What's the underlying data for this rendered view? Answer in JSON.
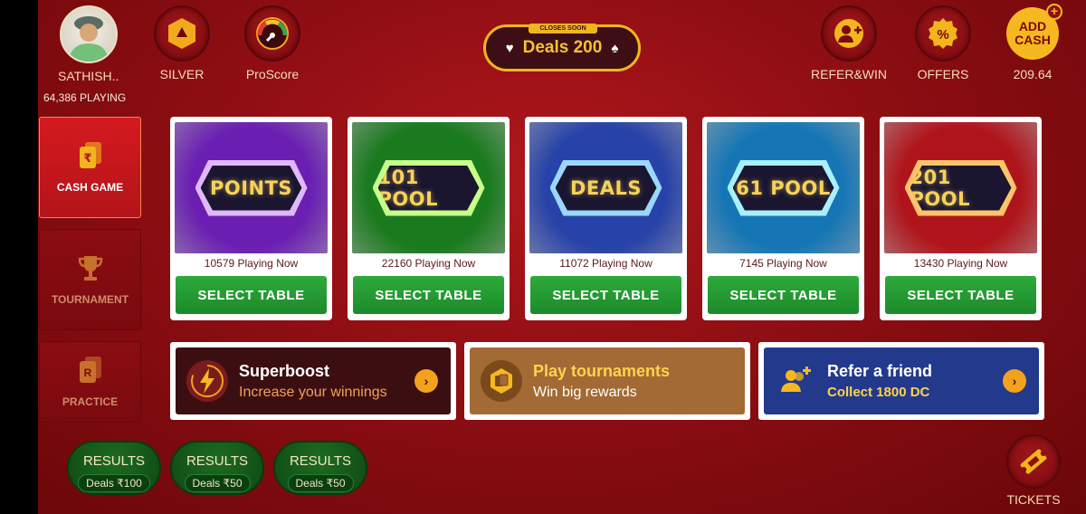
{
  "user": {
    "name": "SATHISH..",
    "playing_count": "64,386 PLAYING"
  },
  "rank": {
    "label": "SILVER"
  },
  "proscore": {
    "label": "ProScore"
  },
  "deals_banner": {
    "badge": "CLOSES SOON",
    "text": "Deals 200",
    "left_suit": "♥",
    "right_suit": "♠"
  },
  "refer": {
    "label": "REFER&WIN"
  },
  "offers": {
    "label": "OFFERS"
  },
  "wallet": {
    "add_cash_line1": "ADD",
    "add_cash_line2": "CASH",
    "plus": "+",
    "balance": "209.64"
  },
  "nav": [
    {
      "label": "CASH GAME",
      "active": true
    },
    {
      "label": "TOURNAMENT",
      "active": false
    },
    {
      "label": "PRACTICE",
      "active": false
    }
  ],
  "games": [
    {
      "title": "POINTS",
      "playing": "10579 Playing Now",
      "button": "SELECT TABLE",
      "bg": "#6a1fb2",
      "light": "#e0b8ff"
    },
    {
      "title": "101 POOL",
      "playing": "22160 Playing Now",
      "button": "SELECT TABLE",
      "bg": "#1a7a1e",
      "light": "#c8ff8a"
    },
    {
      "title": "DEALS",
      "playing": "11072 Playing Now",
      "button": "SELECT TABLE",
      "bg": "#2742a8",
      "light": "#9ad8ff"
    },
    {
      "title": "61 POOL",
      "playing": "7145 Playing Now",
      "button": "SELECT TABLE",
      "bg": "#1676b5",
      "light": "#a8f0ff"
    },
    {
      "title": "201 POOL",
      "playing": "13430 Playing Now",
      "button": "SELECT TABLE",
      "bg": "#b0141b",
      "light": "#ffc46a"
    }
  ],
  "promos": [
    {
      "title": "Superboost",
      "subtitle": "Increase your winnings",
      "icon": "lightning-icon",
      "bg": "#3b0f12",
      "title_color": "#ffffff",
      "sub_color": "#f2a05a"
    },
    {
      "title": "Play tournaments",
      "subtitle": "Win big rewards",
      "icon": "cards-icon",
      "bg": "#a36a35",
      "title_color": "#ffd34d",
      "sub_color": "#ffffff"
    },
    {
      "title": "Refer a friend",
      "subtitle": "Collect 1800 DC",
      "icon": "add-user-icon",
      "bg": "#233a8c",
      "title_color": "#ffffff",
      "sub_color": "#ffd34d"
    }
  ],
  "results": [
    {
      "label": "RESULTS",
      "sub": "Deals ₹100"
    },
    {
      "label": "RESULTS",
      "sub": "Deals ₹50"
    },
    {
      "label": "RESULTS",
      "sub": "Deals ₹50"
    }
  ],
  "tickets": {
    "label": "TICKETS"
  },
  "colors": {
    "accent": "#f2b51c",
    "background": "#a01218",
    "button_green": "#2eaa3c"
  }
}
